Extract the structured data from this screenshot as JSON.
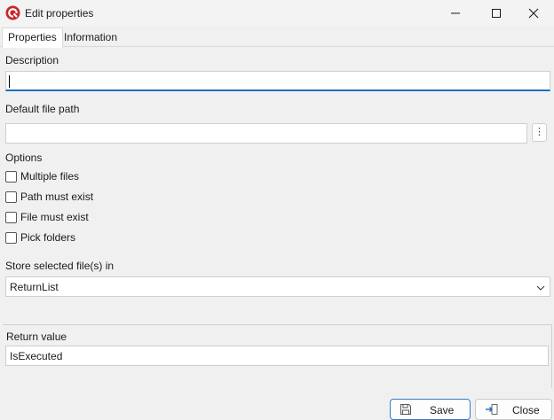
{
  "window": {
    "title": "Edit properties",
    "app_icon": "app-logo-icon"
  },
  "tabs": [
    {
      "label": "Properties",
      "active": true
    },
    {
      "label": "Information",
      "active": false
    }
  ],
  "form": {
    "description_label": "Description",
    "description_value": "",
    "default_path_label": "Default file path",
    "default_path_value": "",
    "browse_button_glyph": "⋮",
    "options_label": "Options",
    "options": [
      {
        "label": "Multiple files",
        "checked": false
      },
      {
        "label": "Path must exist",
        "checked": false
      },
      {
        "label": "File must exist",
        "checked": false
      },
      {
        "label": "Pick folders",
        "checked": false
      }
    ],
    "store_label": "Store selected file(s) in",
    "store_value": "ReturnList",
    "return_label": "Return value",
    "return_value": "IsExecuted"
  },
  "footer": {
    "save_label": "Save",
    "close_label": "Close"
  },
  "colors": {
    "accent": "#1d6fb8",
    "background": "#f0f0f0",
    "app_icon": "#c8262b"
  }
}
